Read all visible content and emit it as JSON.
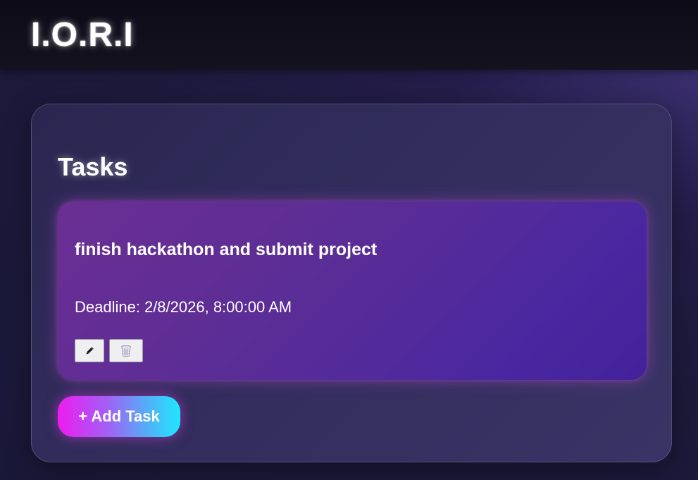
{
  "header": {
    "brand": "I.O.R.I"
  },
  "tasks_panel": {
    "title": "Tasks",
    "tasks": [
      {
        "title": "finish hackathon and submit project",
        "deadline_label": "Deadline:",
        "deadline_value": "2/8/2026, 8:00:00 AM",
        "edit_icon": "pencil-icon",
        "delete_icon": "trash-icon"
      }
    ],
    "add_button_label": "+ Add Task"
  },
  "colors": {
    "card_gradient_start": "#6b2f93",
    "card_gradient_end": "#42229a",
    "add_button_gradient_start": "#ee1cf0",
    "add_button_gradient_end": "#1fe6ff"
  }
}
